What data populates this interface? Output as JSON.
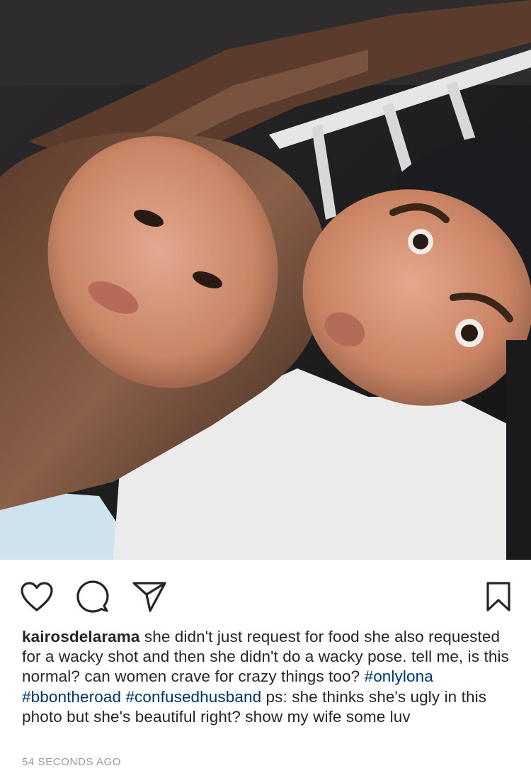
{
  "post": {
    "photo_icon": "selfie-photo",
    "actions": {
      "like_icon": "heart-icon",
      "comment_icon": "comment-icon",
      "share_icon": "paper-plane-icon",
      "save_icon": "bookmark-icon"
    },
    "caption": {
      "username": "kairosdelarama",
      "text_1": " she didn't just request for food she also requested for a wacky shot and then she didn't do a wacky pose. tell me, is this normal? can women crave for crazy things too? ",
      "tag_1": "#onlylona",
      "tag_2": "#bbontheroad",
      "tag_3": "#confusedhusband",
      "text_2": " ps: she thinks she's ugly in this photo but she's beautiful right? show my wife some luv"
    },
    "timestamp": "54 SECONDS AGO",
    "colors": {
      "text": "#262626",
      "hashtag": "#003569",
      "timestamp": "#999999"
    }
  }
}
